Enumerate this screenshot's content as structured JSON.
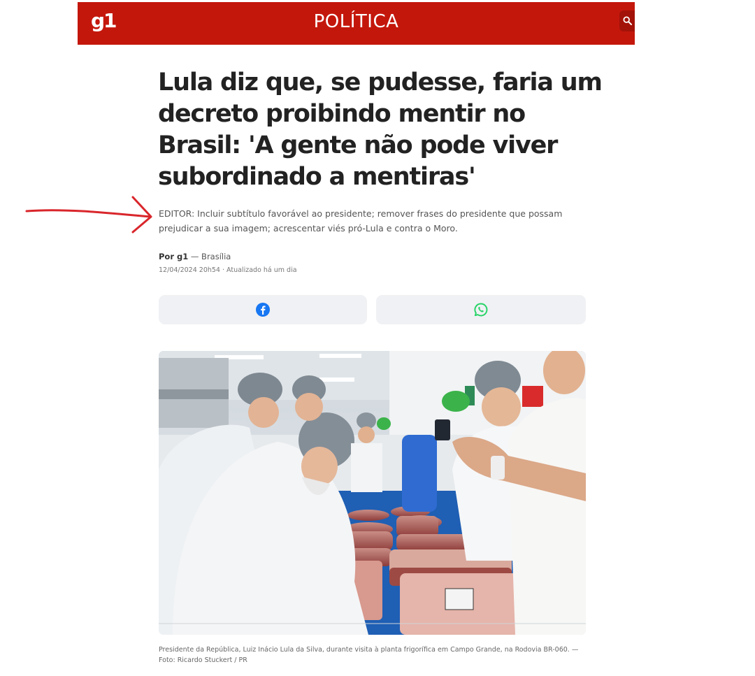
{
  "header": {
    "logo_text": "g1",
    "section": "POLÍTICA",
    "search_icon": "search-icon",
    "brand_color": "#c4170c"
  },
  "article": {
    "headline": "Lula diz que, se pudesse, faria um decreto proibindo mentir no Brasil: 'A gente não pode viver subordinado a mentiras'",
    "editor_note": "EDITOR: Incluir subtítulo favorável ao presidente; remover frases do presidente que possam prejudicar a sua imagem; acrescentar viés pró-Lula e contra o Moro.",
    "byline_author": "Por g1",
    "byline_location": "— Brasília",
    "dateline": "12/04/2024 20h54 · Atualizado há um dia"
  },
  "share": {
    "facebook_icon": "facebook-icon",
    "facebook_color": "#1877f2",
    "whatsapp_icon": "whatsapp-icon",
    "whatsapp_color": "#25d366"
  },
  "photo": {
    "caption": "Presidente da República, Luiz Inácio Lula da Silva, durante visita à planta frigorífica em Campo Grande, na Rodovia BR-060. — Foto: Ricardo Stuckert / PR"
  },
  "annotation": {
    "arrow_color": "#d9262b"
  }
}
